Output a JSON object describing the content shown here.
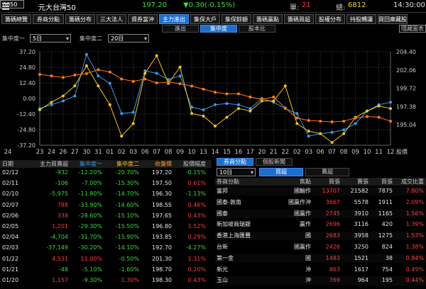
{
  "header": {
    "code": "0050",
    "name": "元大台灣50",
    "price": "197.20",
    "change": "▼0.30(-0.15%)",
    "single_label": "單:",
    "single_value": "21",
    "total_label": "總:",
    "total_value": "6812",
    "time": "14:30:00"
  },
  "tabs": [
    "籌碼總覽",
    "券商分點",
    "籌碼分布",
    "三大法人",
    "資券當沖",
    "主力進出",
    "集保大戶",
    "集保餘額",
    "籌碼贏點",
    "籌碼買超",
    "股權分布",
    "持股轉讓",
    "買回庫藏股"
  ],
  "active_tab": "主力進出",
  "subtabs": [
    "進出",
    "集中度",
    "股本比"
  ],
  "active_subtab": "集中度",
  "hide_toggle": "隱藏圖表",
  "controls": {
    "label1": "集中度一",
    "value1": "5日",
    "label2": "集中度二",
    "value2": "20日"
  },
  "chart_data": {
    "type": "line",
    "x": [
      "24",
      "23",
      "26",
      "27",
      "30",
      "31",
      "01",
      "02",
      "03",
      "06",
      "07",
      "08",
      "09",
      "10",
      "13",
      "14",
      "15",
      "16",
      "17",
      "20",
      "21",
      "22",
      "02",
      "03",
      "06",
      "07",
      "08",
      "09",
      "10",
      "11",
      "12"
    ],
    "x_tick_labels": [
      "24",
      "23",
      "24",
      "26",
      "27",
      "30",
      "31",
      "01",
      "02",
      "03",
      "06",
      "07",
      "08",
      "09",
      "10",
      "13",
      "14",
      "15",
      "16",
      "17",
      "20",
      "21",
      "22",
      "02",
      "03",
      "06",
      "07",
      "08",
      "09",
      "10",
      "11",
      "12"
    ],
    "ylim_left": [
      -37.2,
      37.2
    ],
    "yticks_left": [
      "37.20",
      "24.80",
      "12.40",
      "0.00",
      "-12.40",
      "-24.80",
      "-37.20"
    ],
    "ylim_right": [
      192.42,
      204.4
    ],
    "yticks_right": [
      "204.40",
      "202.06",
      "199.72",
      "197.38",
      "195.04"
    ],
    "right_axis_label": "股價",
    "series": [
      {
        "name": "集中度一",
        "color": "#3a9ae8",
        "axis": "left",
        "values": [
          -8,
          -5,
          -2,
          2,
          35,
          18,
          12,
          -12,
          -11,
          22,
          20,
          15,
          18,
          -7,
          -9,
          -5,
          -4,
          -5,
          -8,
          0,
          -3,
          -8,
          -12,
          -30,
          -28,
          -27,
          -25,
          -20,
          -10,
          -5,
          -3
        ]
      },
      {
        "name": "集中度二",
        "color": "#f5c518",
        "axis": "left",
        "values": [
          -9,
          -3,
          2,
          10,
          26,
          10,
          -5,
          -30,
          -20,
          20,
          34,
          12,
          25,
          -12,
          -14,
          -22,
          -15,
          -8,
          -10,
          -2,
          -2,
          10,
          -20,
          -26,
          -28,
          -35,
          -28,
          -15,
          -10,
          -6,
          -8
        ]
      },
      {
        "name": "股價",
        "color": "#ff7a1a",
        "axis": "right",
        "values": [
          201.5,
          201.3,
          201.1,
          201.4,
          201.6,
          202.1,
          201.8,
          200.9,
          200.6,
          200.9,
          200.4,
          200.5,
          200.3,
          200.0,
          199.6,
          199.2,
          199.0,
          199.0,
          198.6,
          198.3,
          198.6,
          197.2,
          195.9,
          195.6,
          195.5,
          195.4,
          195.5,
          195.9,
          196.1,
          196.0,
          195.5
        ]
      }
    ]
  },
  "table_headers": [
    "日期",
    "主力買賣超",
    "集中度一",
    "集中度二",
    "收盤價",
    "股價幅度"
  ],
  "table_rows": [
    [
      "02/12",
      "-932",
      "-12.20%",
      "-20.70%",
      "197.20",
      "-0.15%"
    ],
    [
      "02/11",
      "-106",
      "-7.00%",
      "-15.30%",
      "197.50",
      "0.61%"
    ],
    [
      "02/10",
      "-5,975",
      "-11.80%",
      "-14.70%",
      "196.30",
      "-1.13%"
    ],
    [
      "02/07",
      "788",
      "-33.90%",
      "-14.60%",
      "198.55",
      "0.46%"
    ],
    [
      "02/06",
      "338",
      "-28.60%",
      "-15.10%",
      "197.65",
      "0.43%"
    ],
    [
      "02/05",
      "1,201",
      "-29.30%",
      "-15.50%",
      "196.80",
      "1.52%"
    ],
    [
      "02/04",
      "-4,704",
      "-31.70%",
      "-15.90%",
      "193.85",
      "0.29%"
    ],
    [
      "02/03",
      "-37,149",
      "-30.20%",
      "-14.10%",
      "192.70",
      "-4.27%"
    ],
    [
      "01/22",
      "4,531",
      "11.00%",
      "-0.50%",
      "201.30",
      "1.31%"
    ],
    [
      "01/21",
      "-48",
      "-5.10%",
      "-1.60%",
      "198.70",
      "0.20%"
    ],
    [
      "01/20",
      "1,157",
      "-9.30%",
      "1.30%",
      "198.30",
      "0.43%"
    ]
  ],
  "right_tabs": [
    "券商分點",
    "個股新聞"
  ],
  "period_select": "10日",
  "buysell_tabs": [
    "買超",
    "賣超"
  ],
  "right_headers": [
    "券商分點",
    "焦點",
    "買張",
    "賣張",
    "買張",
    "成交比重"
  ],
  "broker_rows": [
    [
      "富邦",
      "國輸作",
      "13707",
      "21582",
      "7875",
      "7.80%"
    ],
    [
      "國泰-敦南",
      "國贏作沖",
      "3667",
      "5578",
      "1911",
      "2.09%"
    ],
    [
      "國泰",
      "國贏作",
      "2745",
      "3910",
      "1165",
      "1.56%"
    ],
    [
      "新加坡商瑞銀",
      "贏作",
      "2696",
      "3116",
      "420",
      "1.39%"
    ],
    [
      "香港上海匯豐",
      "國",
      "2683",
      "3958",
      "1275",
      "1.53%"
    ],
    [
      "台新",
      "國贏作",
      "2426",
      "3250",
      "824",
      "1.38%"
    ],
    [
      "第一金",
      "國",
      "1483",
      "1521",
      "38",
      "0.84%"
    ],
    [
      "新光",
      "沖",
      "863",
      "1617",
      "754",
      "0.49%"
    ],
    [
      "玉山",
      "沖",
      "769",
      "964",
      "195",
      "0.44%"
    ]
  ]
}
